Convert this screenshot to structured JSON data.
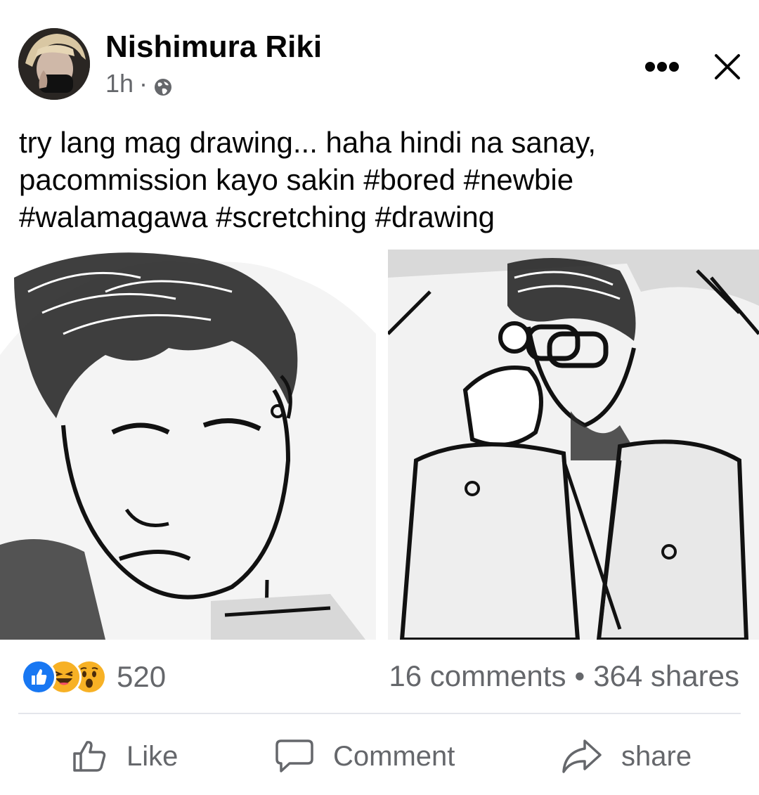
{
  "post": {
    "author": "Nishimura Riki",
    "time": "1h",
    "dot": "·",
    "text_line1": "try lang mag drawing... haha hindi na sanay,",
    "text_line2": "pacommission kayo sakin #bored #newbie",
    "text_line3": "#walamagawa #scretching #drawing",
    "audience_icon": "globe-icon"
  },
  "stats": {
    "reaction_count": "520",
    "reactions": [
      "like",
      "haha",
      "wow"
    ],
    "comments": "16 comments",
    "separator": "•",
    "shares": "364 shares"
  },
  "actions": {
    "like_label": "Like",
    "comment_label": "Comment",
    "share_label": "share"
  },
  "colors": {
    "like_blue": "#1877f2",
    "emoji_yellow": "#f7b125",
    "secondary_text": "#65676b"
  }
}
